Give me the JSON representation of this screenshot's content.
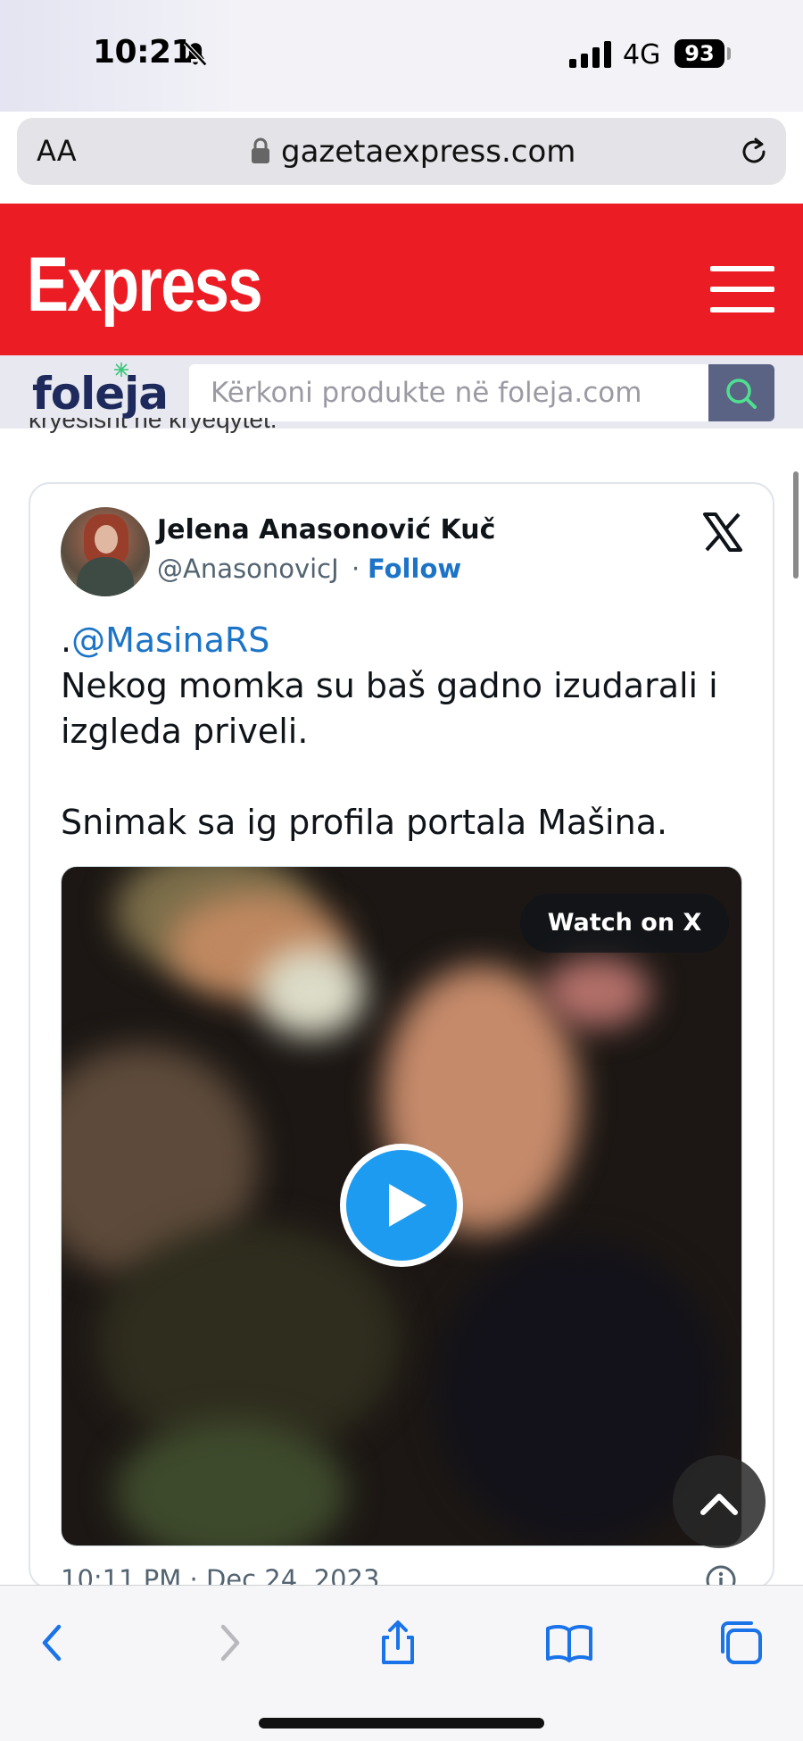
{
  "status_bar": {
    "time": "10:21",
    "network": "4G",
    "battery": "93"
  },
  "browser": {
    "text_size_label": "AA",
    "url": "gazetaexpress.com"
  },
  "site_header": {
    "logo": "Express",
    "accent_color": "#ec1c24"
  },
  "foleja": {
    "logo": "foleja",
    "search_placeholder": "Kërkoni produkte në foleja.com"
  },
  "article": {
    "cut_off_text": "kryesisht në kryeqytet."
  },
  "tweet": {
    "author_name": "Jelena Anasonović Kuč",
    "author_handle": "@AnasonovicJ",
    "separator": "·",
    "follow_label": "Follow",
    "mention_prefix": ".",
    "mention": "@MasinaRS",
    "line1": "Nekog momka su baš gadno izudarali i",
    "line2": "izgleda priveli.",
    "line3": "Snimak sa ig profila portala Mašina.",
    "watch_label": "Watch on X",
    "date": "10:11 PM · Dec 24, 2023"
  },
  "icons": {
    "bell": "bell-slash-icon",
    "signal": "cellular-signal-icon",
    "lock": "lock-icon",
    "reload": "reload-icon",
    "menu": "hamburger-menu-icon",
    "search": "search-icon",
    "x_logo": "x-logo-icon",
    "play": "play-icon",
    "info": "info-icon",
    "scroll_top": "chevron-up-icon",
    "back": "chevron-left-icon",
    "forward": "chevron-right-icon",
    "share": "share-icon",
    "bookmarks": "book-icon",
    "tabs": "tabs-icon"
  }
}
